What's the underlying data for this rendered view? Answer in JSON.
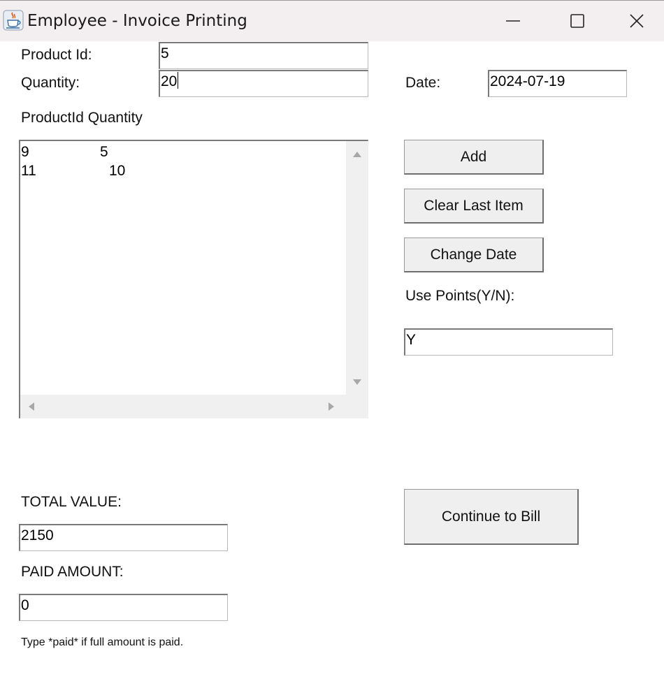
{
  "window": {
    "title": "Employee - Invoice Printing",
    "icon": "java-cup-icon",
    "controls": [
      "minimize-icon",
      "maximize-icon",
      "close-icon"
    ]
  },
  "form": {
    "product_id_label": "Product Id:",
    "product_id_value": "5",
    "quantity_label": "Quantity:",
    "quantity_value": "20",
    "date_label": "Date:",
    "date_value": "2024-07-19"
  },
  "items": {
    "header": "ProductId  Quantity",
    "rows": [
      {
        "product_id": "9",
        "quantity": "5"
      },
      {
        "product_id": "11",
        "quantity": "10"
      }
    ]
  },
  "actions": {
    "add_label": "Add",
    "clear_last_label": "Clear Last Item",
    "change_date_label": "Change Date",
    "continue_label": "Continue to Bill"
  },
  "points": {
    "label": "Use Points(Y/N):",
    "value": "Y"
  },
  "totals": {
    "total_label": "TOTAL VALUE:",
    "total_value": "2150",
    "paid_label": "PAID AMOUNT:",
    "paid_value": "0",
    "hint": "Type *paid* if full amount is paid."
  }
}
